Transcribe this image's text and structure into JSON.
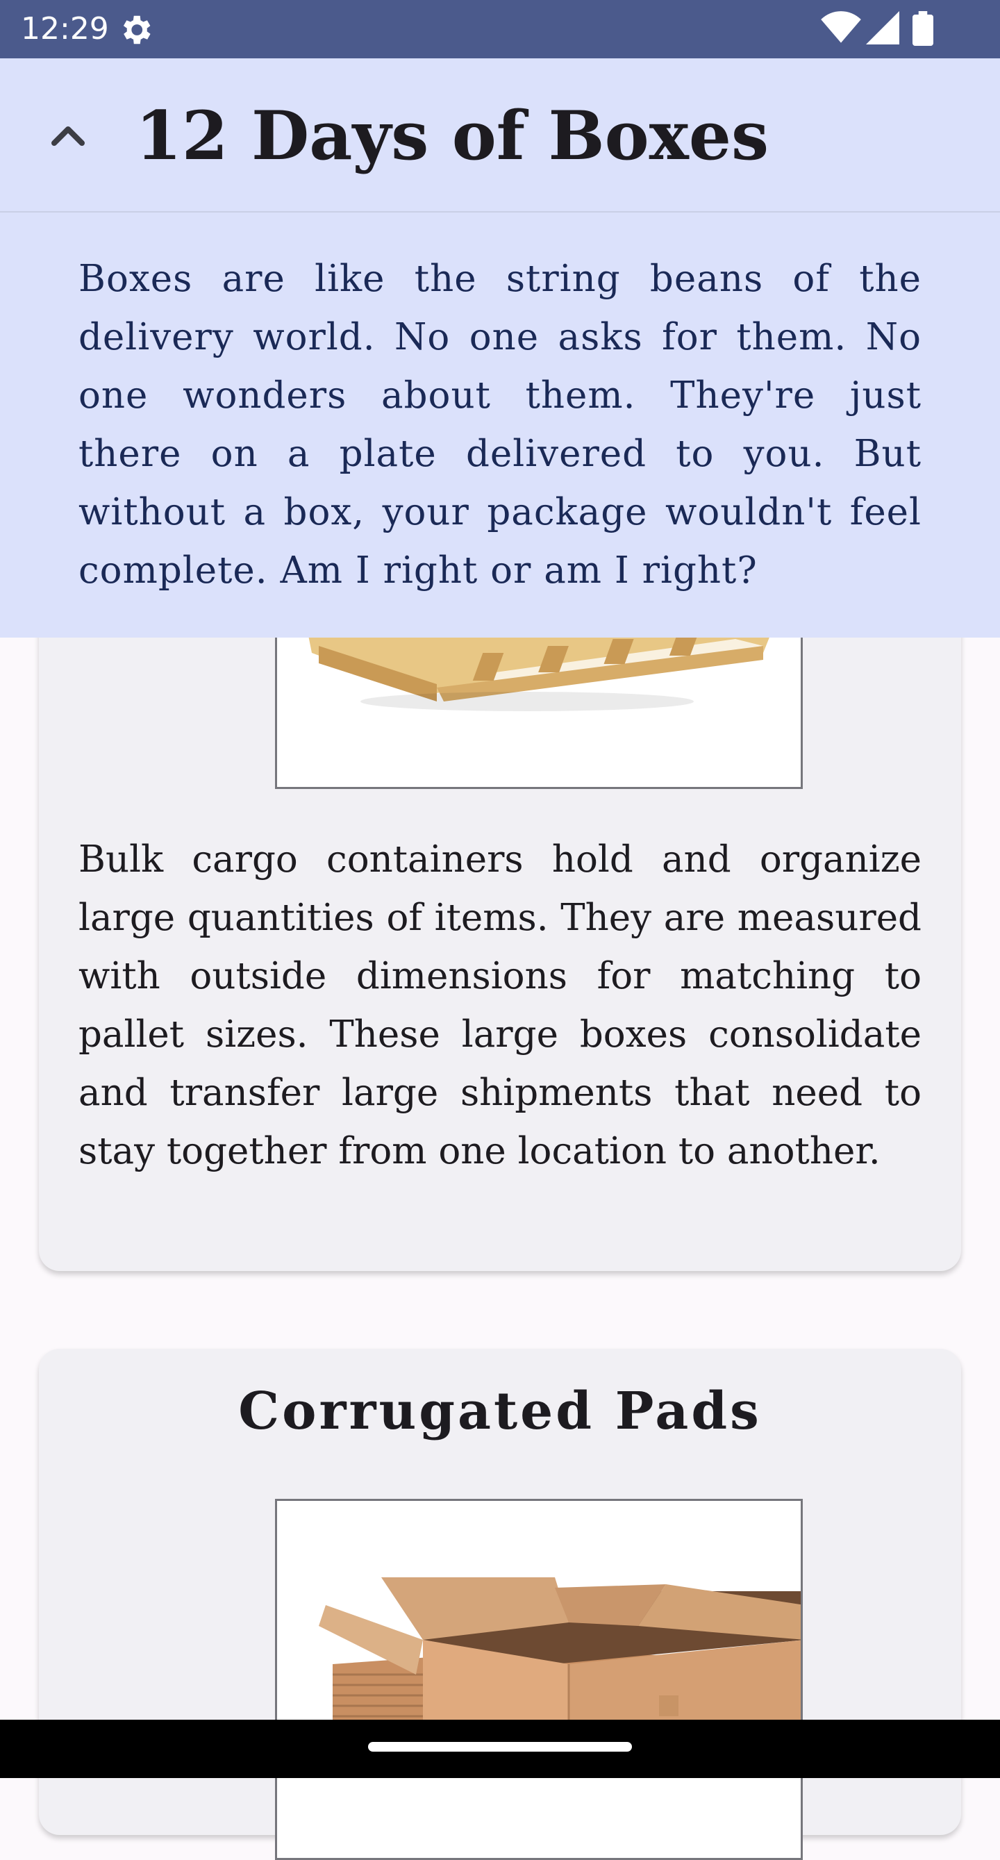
{
  "status_bar": {
    "time": "12:29",
    "icons": [
      "settings-gear-icon",
      "wifi-icon",
      "cellular-signal-icon",
      "battery-icon"
    ]
  },
  "app_bar": {
    "title": "12 Days of Boxes",
    "collapse_icon": "chevron-up-icon"
  },
  "description": {
    "text": "Boxes are like the string beans of the delivery world. No one asks for them. No one wonders about them. They're just there on a plate delivered to you. But without a box, your package wouldn't feel complete. Am I right or am I right?"
  },
  "cards": [
    {
      "image": "cardboard-box-on-pallet-image",
      "body": "Bulk cargo containers hold and organize large quantities of items. They are measured with outside dimensions for matching to pallet sizes. These large boxes consolidate and transfer large shipments that need to stay together from one location to another."
    },
    {
      "title": "Corrugated Pads",
      "image": "open-cardboard-box-image"
    }
  ],
  "colors": {
    "status_bar": "#4b5a8c",
    "app_bar": "#dbe1fb",
    "card": "#f1f0f4",
    "background": "#fcf9fc",
    "description_text": "#1a2956"
  }
}
